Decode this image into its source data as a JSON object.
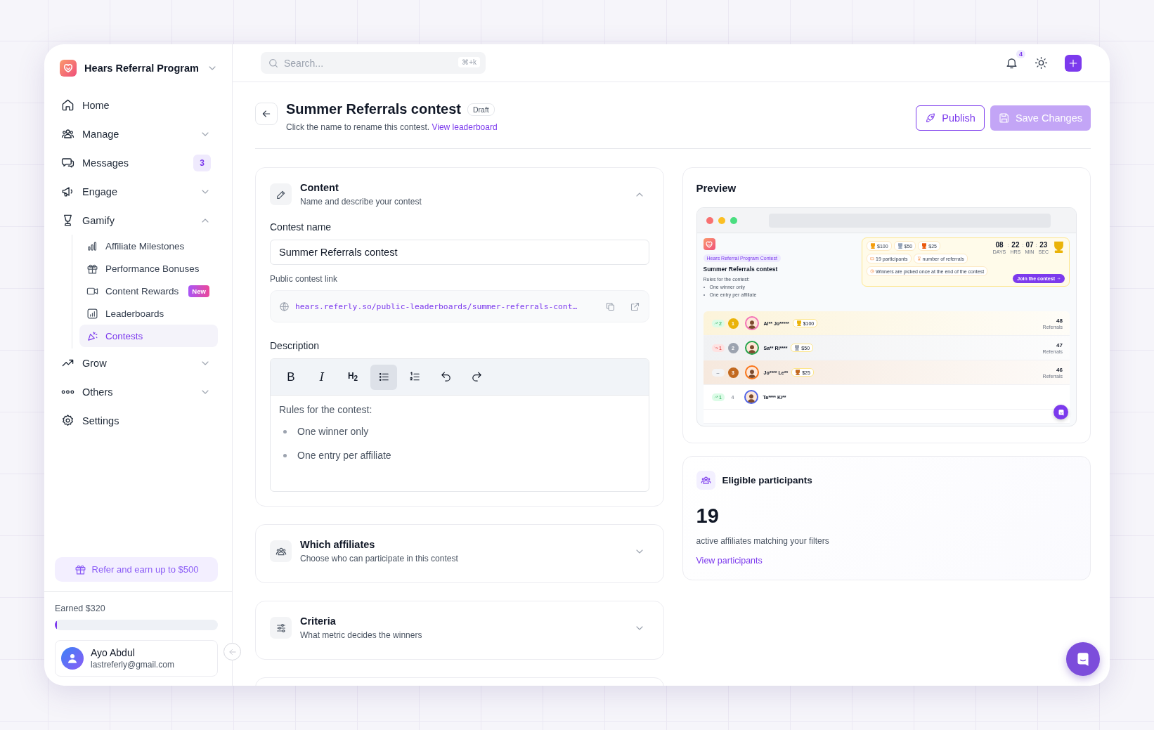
{
  "sidebar": {
    "workspace": "Hears Referral Program",
    "nav": [
      {
        "label": "Home",
        "kind": "link",
        "selected": false
      },
      {
        "label": "Manage",
        "kind": "group",
        "expanded": false,
        "selected": false
      },
      {
        "label": "Messages",
        "kind": "link",
        "badge": "3",
        "selected": false
      },
      {
        "label": "Engage",
        "kind": "group",
        "expanded": false,
        "selected": false
      },
      {
        "label": "Gamify",
        "kind": "group",
        "expanded": true,
        "selected": false,
        "children": [
          {
            "label": "Affiliate Milestones",
            "selected": false
          },
          {
            "label": "Performance Bonuses",
            "selected": false
          },
          {
            "label": "Content Rewards",
            "badge": "New",
            "selected": false
          },
          {
            "label": "Leaderboards",
            "selected": false
          },
          {
            "label": "Contests",
            "selected": true
          }
        ]
      },
      {
        "label": "Grow",
        "kind": "group",
        "expanded": false,
        "selected": false
      },
      {
        "label": "Others",
        "kind": "group",
        "expanded": false,
        "selected": false
      },
      {
        "label": "Settings",
        "kind": "link",
        "selected": false
      }
    ],
    "refer_button": "Refer and earn up to $500",
    "earnings": {
      "label": "Earned $320",
      "level": 0.01
    },
    "user": {
      "name": "Ayo Abdul",
      "email": "lastreferly@gmail.com"
    }
  },
  "topbar": {
    "search": {
      "placeholder": "Search...",
      "shortcut": "⌘+k"
    },
    "notifications": "4"
  },
  "header": {
    "title": "Summer Referrals contest",
    "status": "Draft",
    "hint": "Click the name to rename this contest.",
    "link": "View leaderboard",
    "buttons": [
      {
        "label": "Publish",
        "kind": "outline",
        "disabled": false
      },
      {
        "label": "Save Changes",
        "kind": "primary",
        "disabled": true
      }
    ]
  },
  "sections": [
    {
      "title": "Content",
      "subtitle": "Name and describe your contest",
      "expanded": true
    },
    {
      "title": "Which affiliates",
      "subtitle": "Choose who can participate in this contest",
      "expanded": false
    },
    {
      "title": "Criteria",
      "subtitle": "What metric decides the winners",
      "expanded": false
    }
  ],
  "content_form": {
    "name_label": "Contest name",
    "name_value": "Summer Referrals contest",
    "link_label": "Public contest link",
    "link_value": "hears.referly.so/public-leaderboards/summer-referrals-cont…",
    "description_label": "Description",
    "toolbar": [
      {
        "kind": "bold",
        "label": "B",
        "selected": false
      },
      {
        "kind": "italic",
        "label": "I",
        "selected": false
      },
      {
        "kind": "heading",
        "label": "H$_{2}$",
        "selected": false
      },
      {
        "kind": "bullet_list",
        "selected": true
      },
      {
        "kind": "ordered_list",
        "selected": false
      },
      {
        "kind": "undo",
        "selected": false
      },
      {
        "kind": "redo",
        "selected": false
      }
    ],
    "intro": "Rules for the contest:",
    "bullets": [
      "One winner only",
      "One entry per affiliate"
    ]
  },
  "preview": {
    "title": "Preview",
    "page": {
      "badge": "Hears Referral Program Contest",
      "title": "Summer Referrals contest",
      "intro": "Rules for the contest:",
      "bullets": [
        "One winner only",
        "One entry per affiliate"
      ],
      "prizes": [
        {
          "amount": "$100",
          "color": "#f59e0b"
        },
        {
          "amount": "$50",
          "color": "#94a3b8"
        },
        {
          "amount": "$25",
          "color": "#ea580c"
        }
      ],
      "facts": [
        "19 participants",
        "number of referrals",
        "Winners are picked once at the end of the contest"
      ],
      "countdown": [
        {
          "value": "08",
          "unit": "DAYS",
          "separator": ":"
        },
        {
          "value": "22",
          "unit": "HRS",
          "separator": ":"
        },
        {
          "value": "07",
          "unit": "MIN",
          "separator": ":"
        },
        {
          "value": "23",
          "unit": "SEC"
        }
      ],
      "join_button": "Join the contest",
      "rows": [
        {
          "change": {
            "kind": "up",
            "value": "2"
          },
          "rank": "1",
          "color": "#eab308",
          "name": "Al** Jo*****",
          "prize": "$100",
          "referrals": "48",
          "unit": "Referrals"
        },
        {
          "change": {
            "kind": "down",
            "value": "1"
          },
          "rank": "2",
          "color": "#9ca3af",
          "name": "Sa** Ri****",
          "prize": "$50",
          "referrals": "47",
          "unit": "Referrals"
        },
        {
          "change": {
            "kind": "same",
            "value": "–"
          },
          "rank": "3",
          "color": "#c2691f",
          "name": "Jo**** Le**",
          "prize": "$25",
          "referrals": "46",
          "unit": "Referrals"
        },
        {
          "change": {
            "kind": "up",
            "value": "1"
          },
          "rank": "4",
          "name": "Ta**** Ki**"
        }
      ]
    }
  },
  "eligible": {
    "title": "Eligible participants",
    "count": "19",
    "caption": "active affiliates matching your filters",
    "link": "View participants"
  }
}
